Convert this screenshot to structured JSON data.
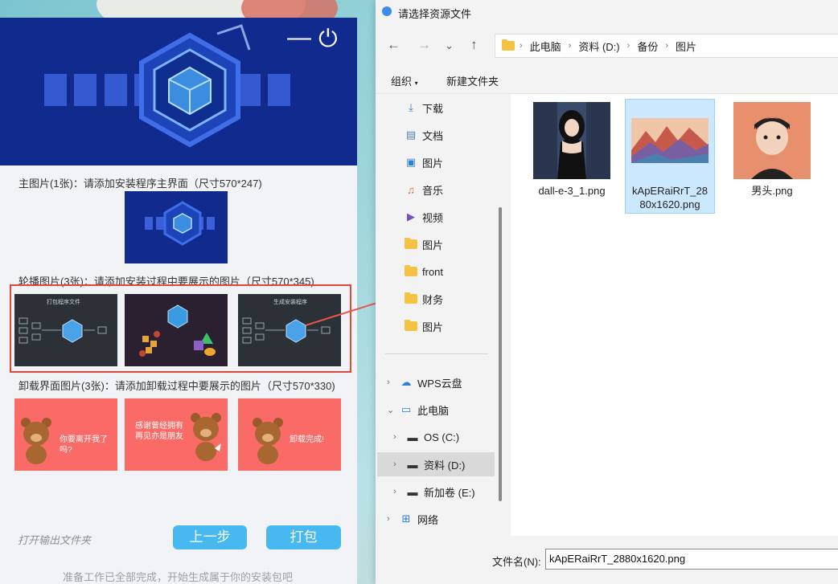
{
  "installer": {
    "labels": {
      "main_image": "主图片(1张)：请添加安装程序主界面（尺寸570*247)",
      "carousel": "轮播图片(3张)：请添加安装过程中要展示的图片（尺寸570*345)",
      "uninstall": "卸载界面图片(3张)：请添加卸载过程中要展示的图片（尺寸570*330)"
    },
    "carousel_titles": [
      "打包程序文件",
      "",
      "生成安装程序"
    ],
    "uninstall_texts": [
      "你要离开我了吗?",
      "感谢曾经拥有\n再见亦是朋友",
      "卸载完成!"
    ],
    "open_output": "打开输出文件夹",
    "prev_button": "上一步",
    "pack_button": "打包",
    "status": "准备工作已全部完成，开始生成属于你的安装包吧"
  },
  "dialog": {
    "title": "请选择资源文件",
    "address": [
      "此电脑",
      "资料 (D:)",
      "备份",
      "图片"
    ],
    "toolbar": {
      "organize": "组织",
      "new_folder": "新建文件夹"
    },
    "nav_items": [
      {
        "label": "下载",
        "icon": "download-icon",
        "pinned": true
      },
      {
        "label": "文档",
        "icon": "document-icon",
        "pinned": true
      },
      {
        "label": "图片",
        "icon": "pictures-icon",
        "pinned": true
      },
      {
        "label": "音乐",
        "icon": "music-icon",
        "pinned": true
      },
      {
        "label": "视频",
        "icon": "video-icon",
        "pinned": true
      },
      {
        "label": "图片",
        "icon": "folder-icon",
        "pinned": false
      },
      {
        "label": "front",
        "icon": "folder-icon",
        "pinned": false
      },
      {
        "label": "财务",
        "icon": "folder-icon",
        "pinned": false
      },
      {
        "label": "图片",
        "icon": "folder-icon",
        "pinned": false
      }
    ],
    "tree_items": [
      {
        "label": "WPS云盘",
        "icon": "cloud-icon",
        "expanded": false
      },
      {
        "label": "此电脑",
        "icon": "computer-icon",
        "expanded": true
      },
      {
        "label": "OS (C:)",
        "icon": "drive-icon",
        "expanded": false
      },
      {
        "label": "资料 (D:)",
        "icon": "drive-icon",
        "expanded": false,
        "selected": true
      },
      {
        "label": "新加卷 (E:)",
        "icon": "drive-icon",
        "expanded": false
      },
      {
        "label": "网络",
        "icon": "network-icon",
        "expanded": false
      }
    ],
    "files": [
      {
        "name": "dall-e-3_1.png"
      },
      {
        "name": "kApERaiRrT_2880x1620.png",
        "selected": true
      },
      {
        "name": "男头.png"
      }
    ],
    "filename_label": "文件名(N):",
    "filename_value": "kApERaiRrT_2880x1620.png"
  },
  "colors": {
    "banner": "#112a8d",
    "accent_button": "#47b8f0",
    "highlight_border": "#e0463c",
    "uninstall_bg": "#fa6a66"
  }
}
